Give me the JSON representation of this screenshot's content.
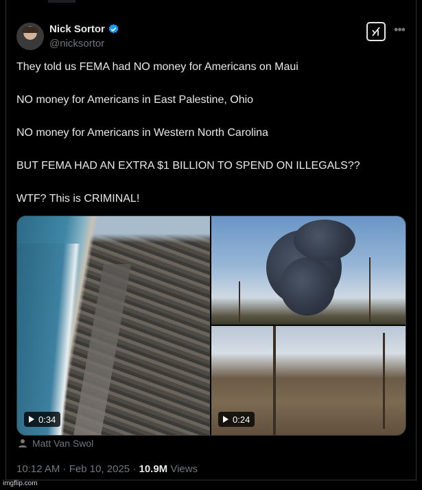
{
  "author": {
    "name": "Nick Sortor",
    "handle": "@nicksortor",
    "verified": true,
    "verified_color": "#1d9bf0"
  },
  "tweet": {
    "lines": [
      "They told us FEMA had NO money for Americans on Maui",
      "NO money for Americans in East Palestine, Ohio",
      "NO money for Americans in Western North Carolina",
      "BUT FEMA HAD AN EXTRA $1 BILLION TO SPEND ON ILLEGALS??",
      "WTF? This is CRIMINAL!"
    ]
  },
  "media": {
    "videos": [
      {
        "duration": "0:34"
      },
      {
        "duration": "0:24"
      }
    ]
  },
  "tagged_user": "Matt Van Swol",
  "meta": {
    "time": "10:12 AM",
    "separator": "·",
    "date": "Feb 10, 2025",
    "views_count": "10.9M",
    "views_label": "Views"
  },
  "icons": {
    "grok": "grok-icon",
    "more": "more-icon",
    "person": "person-icon",
    "play": "play-icon"
  },
  "watermark": "imgflip.com"
}
